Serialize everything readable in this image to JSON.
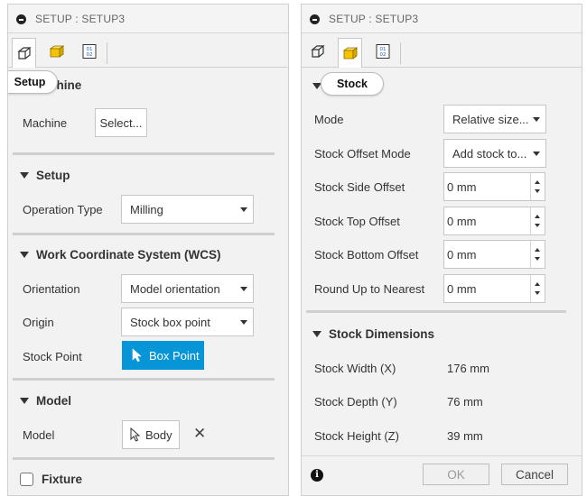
{
  "left_panel": {
    "title": "SETUP : SETUP3",
    "tabs": [
      "setup-tab-icon",
      "stock-tab-icon",
      "post-process-tab-icon"
    ],
    "tooltip": "Setup",
    "machine": {
      "section_partial": "chine",
      "label": "Machine",
      "button": "Select..."
    },
    "setup": {
      "section": "Setup",
      "operation_type_label": "Operation Type",
      "operation_type_value": "Milling"
    },
    "wcs": {
      "section": "Work Coordinate System (WCS)",
      "orientation_label": "Orientation",
      "orientation_value": "Model orientation",
      "origin_label": "Origin",
      "origin_value": "Stock box point",
      "stock_point_label": "Stock Point",
      "stock_point_button": "Box Point"
    },
    "model": {
      "section": "Model",
      "label": "Model",
      "button": "Body"
    },
    "fixture": {
      "section": "Fixture"
    }
  },
  "right_panel": {
    "title": "SETUP : SETUP3",
    "tabs": [
      "setup-tab-icon",
      "stock-tab-icon",
      "post-process-tab-icon"
    ],
    "stock_section": "Stock",
    "mode_label": "Mode",
    "mode_value": "Relative size...",
    "stock_offset_mode_label": "Stock Offset Mode",
    "stock_offset_mode_value": "Add stock to...",
    "stock_side_offset_label": "Stock Side Offset",
    "stock_side_offset_value": "0 mm",
    "stock_top_offset_label": "Stock Top Offset",
    "stock_top_offset_value": "0 mm",
    "stock_bottom_offset_label": "Stock Bottom Offset",
    "stock_bottom_offset_value": "0 mm",
    "round_up_label": "Round Up to Nearest",
    "round_up_value": "0 mm",
    "dimensions_section": "Stock Dimensions",
    "width_label": "Stock Width (X)",
    "width_value": "176 mm",
    "depth_label": "Stock Depth (Y)",
    "depth_value": "76 mm",
    "height_label": "Stock Height (Z)",
    "height_value": "39 mm",
    "ok_label": "OK",
    "cancel_label": "Cancel"
  },
  "colors": {
    "accent": "#0696d7",
    "stock_icon": "#f5c400",
    "panel_bg": "#f2f2f2"
  }
}
